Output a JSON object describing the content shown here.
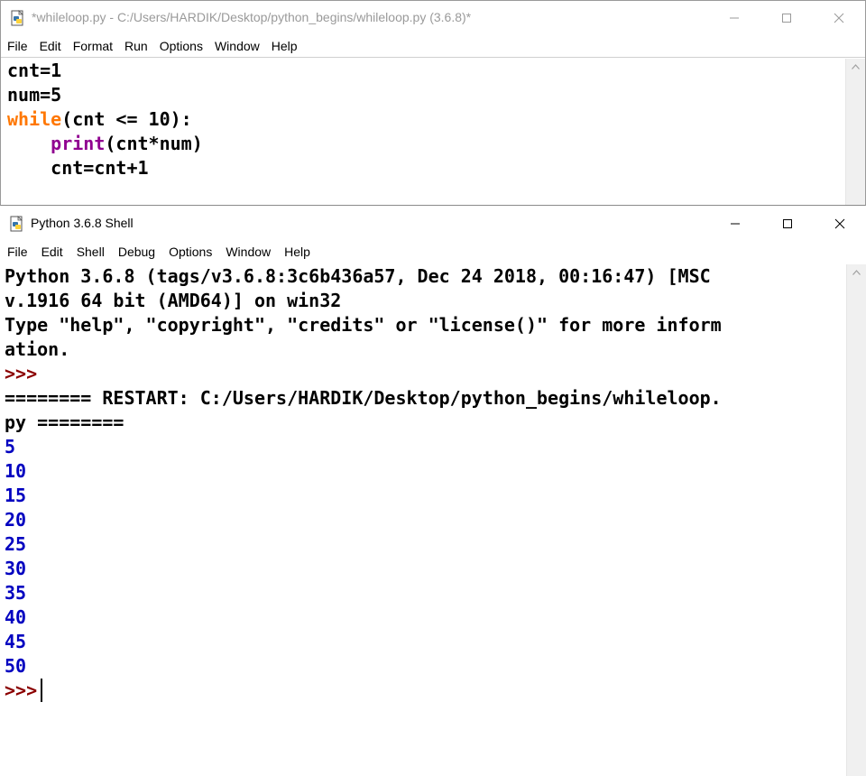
{
  "editor": {
    "title": "*whileloop.py - C:/Users/HARDIK/Desktop/python_begins/whileloop.py (3.6.8)*",
    "menu": [
      "File",
      "Edit",
      "Format",
      "Run",
      "Options",
      "Window",
      "Help"
    ],
    "code": {
      "line1": "cnt=1",
      "line2": "num=5",
      "line3_kw": "while",
      "line3_rest": "(cnt <= 10):",
      "line4_indent": "    ",
      "line4_builtin": "print",
      "line4_rest": "(cnt*num)",
      "line5": "    cnt=cnt+1"
    }
  },
  "shell": {
    "title": "Python 3.6.8 Shell",
    "menu": [
      "File",
      "Edit",
      "Shell",
      "Debug",
      "Options",
      "Window",
      "Help"
    ],
    "banner1": "Python 3.6.8 (tags/v3.6.8:3c6b436a57, Dec 24 2018, 00:16:47) [MSC",
    "banner2": "v.1916 64 bit (AMD64)] on win32",
    "banner3": "Type \"help\", \"copyright\", \"credits\" or \"license()\" for more inform",
    "banner4": "ation.",
    "prompt": ">>>",
    "restart1": "======== RESTART: C:/Users/HARDIK/Desktop/python_begins/whileloop.",
    "restart2": "py ========",
    "outputs": [
      "5",
      "10",
      "15",
      "20",
      "25",
      "30",
      "35",
      "40",
      "45",
      "50"
    ]
  },
  "icons": {
    "editor_window": "python-file-icon",
    "shell_window": "python-shell-icon"
  }
}
